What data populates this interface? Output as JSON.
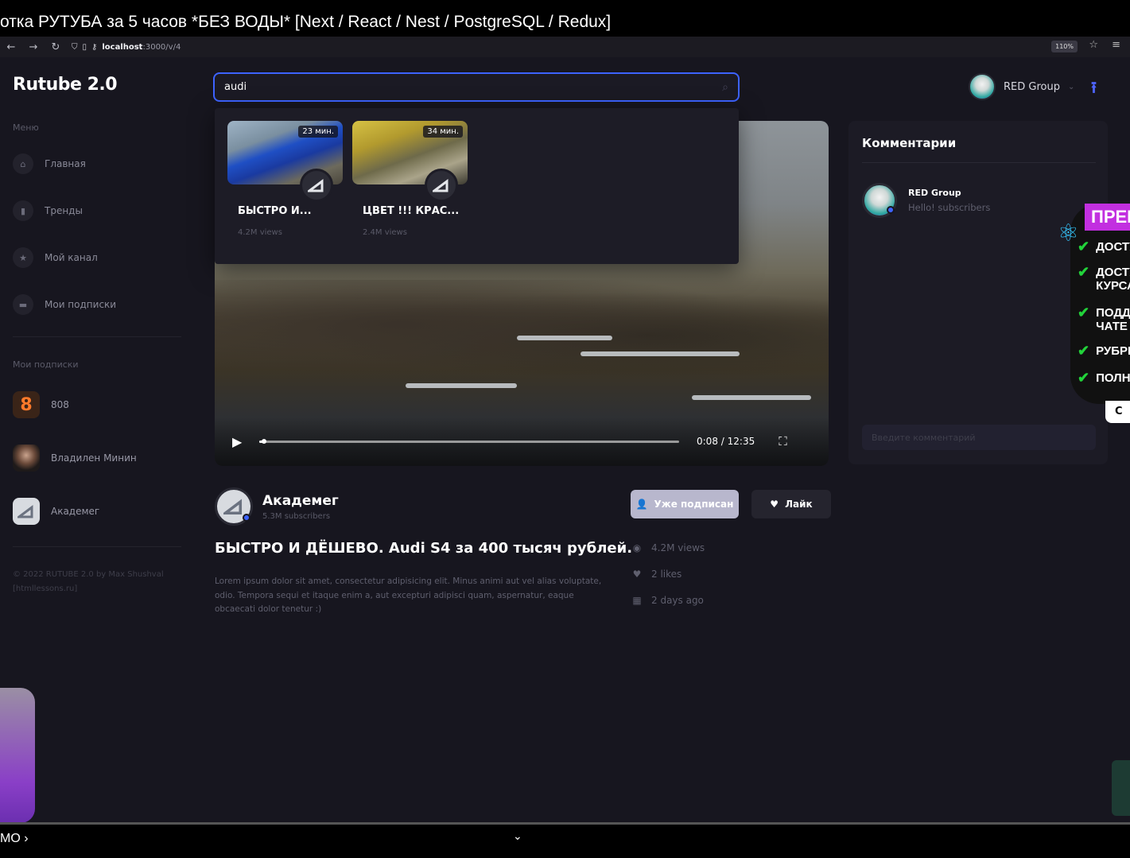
{
  "video_title": "отка РУТУБА за 5 часов *БЕЗ ВОДЫ* [Next / React / Nest / PostgreSQL / Redux]",
  "browser": {
    "host": "localhost",
    "path": ":3000/v/4",
    "zoom": "110%"
  },
  "app": {
    "logo": "Rutube 2.0",
    "menu_label": "Меню",
    "menu": [
      {
        "label": "Главная",
        "icon": "home-icon"
      },
      {
        "label": "Тренды",
        "icon": "chart-icon"
      },
      {
        "label": "Мой канал",
        "icon": "star-icon"
      },
      {
        "label": "Мои подписки",
        "icon": "folder-icon"
      }
    ],
    "subs_label": "Мои подписки",
    "subscriptions": [
      {
        "name": "808",
        "avatar_text": "8"
      },
      {
        "name": "Владилен Минин",
        "avatar_text": ""
      },
      {
        "name": "Академег",
        "avatar_text": ""
      }
    ],
    "footer": "© 2022 RUTUBE 2.0 by Max Shushval [htmllessons.ru]"
  },
  "search": {
    "value": "audi",
    "results": [
      {
        "duration": "23 мин.",
        "title": "БЫСТРО И...",
        "views": "4.2M views"
      },
      {
        "duration": "34 мин.",
        "title": "ЦВЕТ !!! КРАС...",
        "views": "2.4M views"
      }
    ]
  },
  "player": {
    "current": "0:08",
    "separator": "/",
    "total": "12:35",
    "progress": 0.011
  },
  "video": {
    "channel": "Академег",
    "subscribers": "5.3M subscribers",
    "subscribed_label": "Уже подписан",
    "like_label": "Лайк",
    "title": "БЫСТРО И ДЁШЕВО. Audi S4 за 400 тысяч рублей.",
    "description": "Lorem ipsum dolor sit amet, consectetur adipisicing elit. Minus animi aut vel alias voluptate, odio. Tempora sequi et itaque enim a, aut excepturi adipisci quam, aspernatur, eaque obcaecati dolor tenetur :)",
    "views": "4.2M views",
    "likes": "2 likes",
    "date": "2 days ago"
  },
  "header": {
    "user": "RED Group"
  },
  "comments": {
    "title": "Комментарии",
    "items": [
      {
        "author": "RED Group",
        "text": "Hello! subscribers"
      }
    ],
    "placeholder": "Введите комментарий"
  },
  "promo": {
    "head": "ПРЕМ",
    "lines": [
      "ДОСТУ",
      "ДОСТУ КУРСА",
      "ПОДДЕ ЧАТЕ",
      "РУБРИ",
      "ПОЛНЫ"
    ],
    "tail": "С"
  },
  "overlay": {
    "bottom_left": "МО ›"
  },
  "colors": {
    "accent": "#3d63ff",
    "background": "#17161f",
    "panel": "#1c1b25"
  }
}
